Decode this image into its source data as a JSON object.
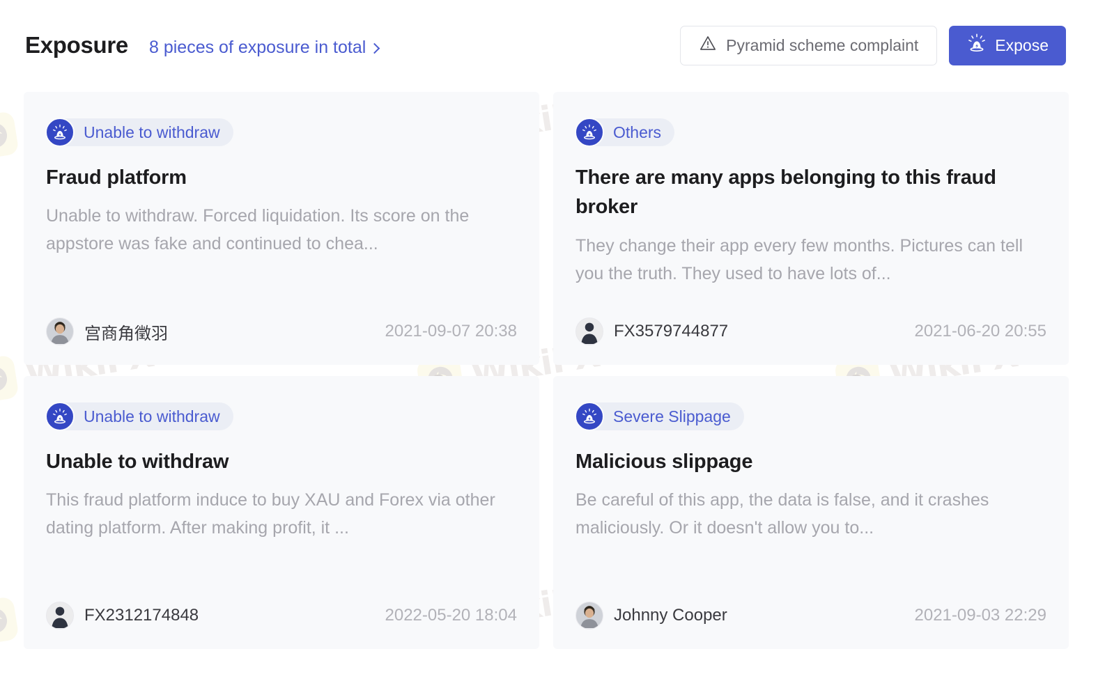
{
  "header": {
    "title": "Exposure",
    "total_link": "8 pieces of exposure in total",
    "chevron_icon": "chevron-right-icon",
    "complaint_button": "Pyramid scheme complaint",
    "complaint_icon": "warning-triangle-icon",
    "expose_button": "Expose",
    "expose_icon": "siren-icon"
  },
  "colors": {
    "brand_blue": "#4a5bd0",
    "siren_blue": "#3447c4",
    "badge_bg": "#ebeef5",
    "card_bg": "#f8f9fb",
    "page_bg": "#ffffff",
    "title_text": "#1d1d1f",
    "desc_text": "#a6a6ad",
    "timestamp_text": "#b2b2b8",
    "watermark_logo": "#fbf6dd",
    "watermark_text": "#e2dedb"
  },
  "watermark": {
    "text": "WikiFX",
    "logo_icon": "wikifx-eagle-logo-icon"
  },
  "cards": [
    {
      "badge": "Unable to withdraw",
      "badge_icon": "siren-icon",
      "title": "Fraud platform",
      "description": "Unable to withdraw. Forced liquidation. Its score on the appstore was fake and continued to chea...",
      "author": "宫商角徵羽",
      "avatar_type": "photo",
      "timestamp": "2021-09-07 20:38"
    },
    {
      "badge": "Others",
      "badge_icon": "siren-icon",
      "title": "There are many apps belonging to this fraud broker",
      "description": "They change their app every few months. Pictures can tell you the truth. They used to have lots of...",
      "author": "FX3579744877",
      "avatar_type": "default",
      "timestamp": "2021-06-20 20:55"
    },
    {
      "badge": "Unable to withdraw",
      "badge_icon": "siren-icon",
      "title": "Unable to withdraw",
      "description": "This fraud platform induce to buy XAU and Forex via other dating platform. After making profit, it ...",
      "author": "FX2312174848",
      "avatar_type": "default",
      "timestamp": "2022-05-20 18:04"
    },
    {
      "badge": "Severe Slippage",
      "badge_icon": "siren-icon",
      "title": "Malicious slippage",
      "description": "Be careful of this app, the data is false, and it crashes maliciously. Or it doesn't allow you to...",
      "author": "Johnny Cooper",
      "avatar_type": "photo",
      "timestamp": "2021-09-03 22:29"
    }
  ]
}
